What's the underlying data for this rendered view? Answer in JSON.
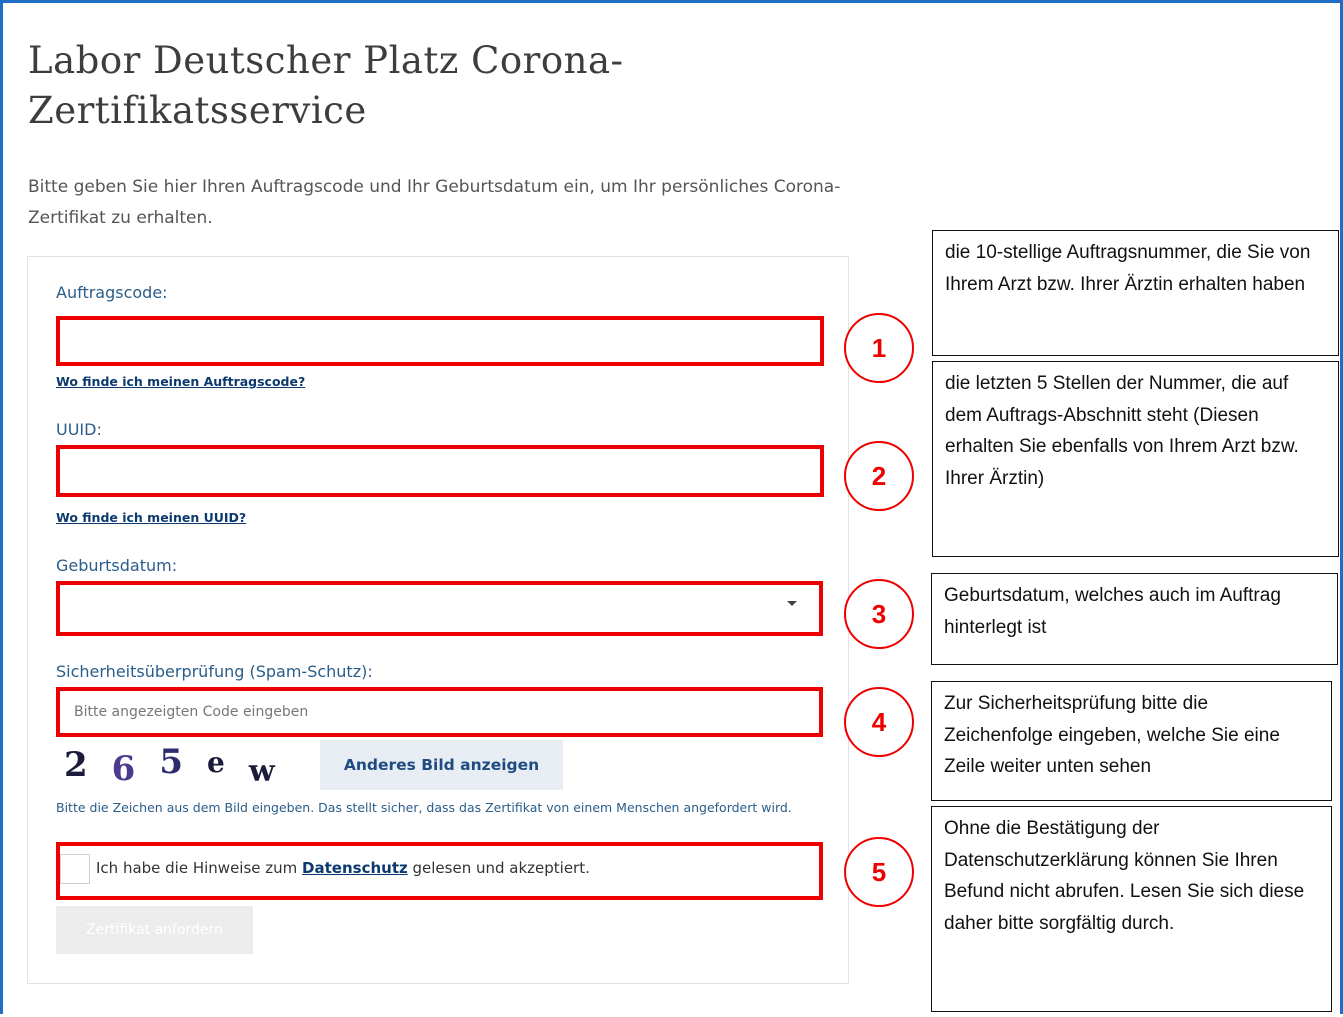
{
  "header": {
    "title": "Labor Deutscher Platz Corona-Zertifikatsservice",
    "intro": "Bitte geben Sie hier Ihren Auftragscode und Ihr Geburtsdatum ein, um Ihr persönliches Corona-Zertifikat zu erhalten."
  },
  "form": {
    "auftragscode": {
      "label": "Auftragscode:",
      "value": "",
      "help_link": "Wo finde ich meinen Auftragscode?"
    },
    "uuid": {
      "label": "UUID:",
      "value": "",
      "help_link": "Wo finde ich meinen UUID?"
    },
    "geburtsdatum": {
      "label": "Geburtsdatum:",
      "selected": ""
    },
    "captcha": {
      "label": "Sicherheitsüberprüfung (Spam-Schutz):",
      "placeholder": "Bitte angezeigten Code eingeben",
      "image_chars": [
        "2",
        "6",
        "5",
        "e",
        "w"
      ],
      "reload_label": "Anderes Bild anzeigen",
      "note": "Bitte die Zeichen aus dem Bild eingeben. Das stellt sicher, dass das Zertifikat von einem Menschen angefordert wird."
    },
    "consent": {
      "text_before": "Ich habe die Hinweise zum ",
      "link": "Datenschutz",
      "text_after": " gelesen und akzeptiert.",
      "checked": false
    },
    "submit_label": "Zertifikat anfordern"
  },
  "annotations": [
    {
      "number": "1",
      "text": "die 10-stellige Auftragsnummer, die Sie von Ihrem Arzt bzw. Ihrer Ärztin erhalten haben"
    },
    {
      "number": "2",
      "text": "die letzten 5 Stellen der Nummer, die auf dem Auftrags-Abschnitt steht (Diesen erhalten Sie ebenfalls von Ihrem Arzt bzw. Ihrer Ärztin)"
    },
    {
      "number": "3",
      "text": "Geburtsdatum, welches auch im Auftrag hinterlegt ist"
    },
    {
      "number": "4",
      "text": "Zur Sicherheitsprüfung bitte die Zeichenfolge eingeben, welche Sie eine Zeile weiter unten sehen"
    },
    {
      "number": "5",
      "text": "Ohne die Bestätigung der Datenschutzerklärung können Sie Ihren Befund nicht abrufen. Lesen Sie sich diese daher bitte sorgfältig durch."
    }
  ],
  "colors": {
    "frame": "#1f6dc4",
    "highlight": "#ee0000",
    "label": "#2a5d8a",
    "link": "#0d3a6e"
  }
}
